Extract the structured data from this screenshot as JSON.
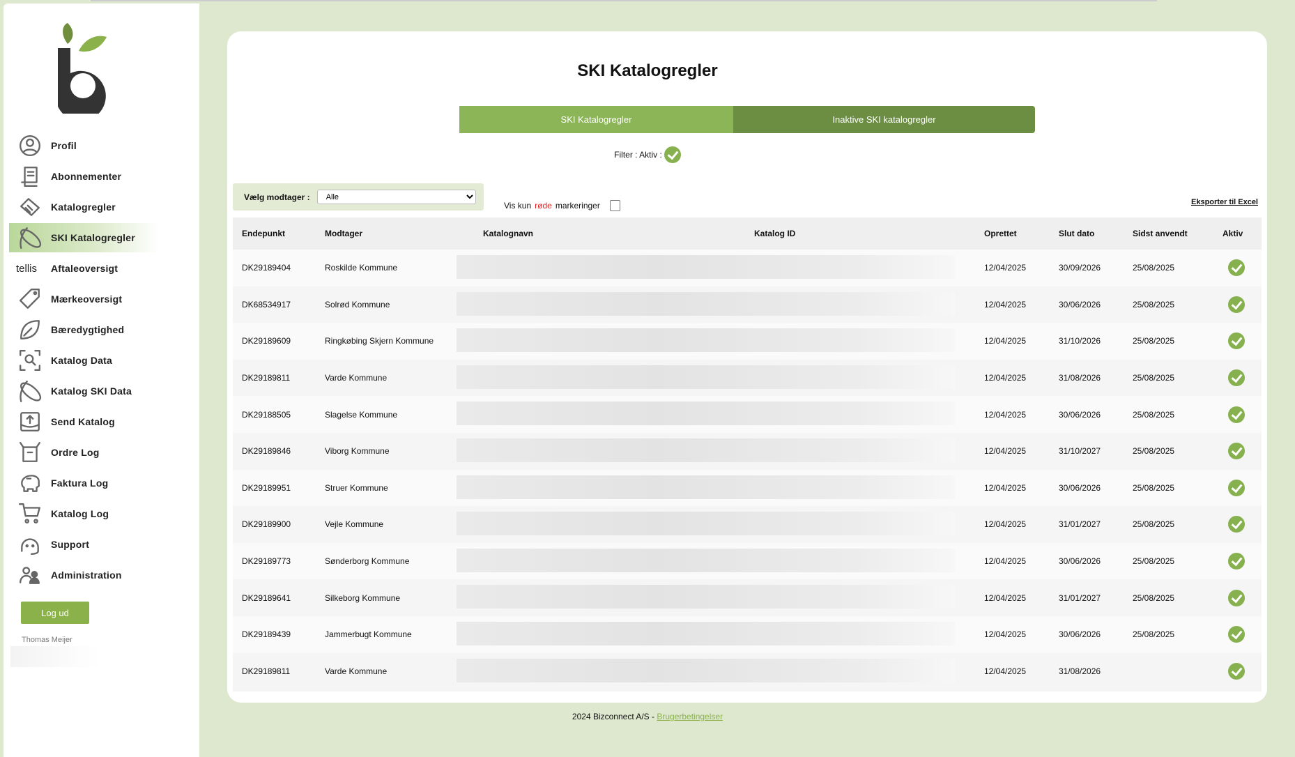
{
  "sidebar": {
    "items": [
      {
        "label": "Profil",
        "icon": "user-circle-icon"
      },
      {
        "label": "Abonnementer",
        "icon": "receipt-icon"
      },
      {
        "label": "Katalogregler",
        "icon": "handshake-icon"
      },
      {
        "label": "SKI Katalogregler",
        "icon": "ski-logo-icon",
        "active": true
      },
      {
        "label": "Aftaleoversigt",
        "icon": "tellis-logo-icon",
        "icon_text": "tellis"
      },
      {
        "label": "Mærkeoversigt",
        "icon": "tag-icon"
      },
      {
        "label": "Bæredygtighed",
        "icon": "leaf-icon"
      },
      {
        "label": "Katalog Data",
        "icon": "search-scan-icon"
      },
      {
        "label": "Katalog SKI Data",
        "icon": "ski-logo-icon"
      },
      {
        "label": "Send Katalog",
        "icon": "upload-tray-icon"
      },
      {
        "label": "Ordre Log",
        "icon": "box-icon"
      },
      {
        "label": "Faktura Log",
        "icon": "piggy-bank-icon"
      },
      {
        "label": "Katalog Log",
        "icon": "cart-icon"
      },
      {
        "label": "Support",
        "icon": "headset-icon"
      },
      {
        "label": "Administration",
        "icon": "users-icon"
      }
    ],
    "logout_label": "Log ud",
    "user_name": "Thomas Meijer"
  },
  "main": {
    "title": "SKI Katalogregler",
    "tabs": [
      {
        "label": "SKI Katalogregler"
      },
      {
        "label": "Inaktive SKI katalogregler"
      }
    ],
    "filter_label": "Filter : Aktiv :",
    "select_label": "Vælg modtager :",
    "select_value": "Alle",
    "red_only": {
      "pre": "Vis kun",
      "red": "røde",
      "post": "markeringer"
    },
    "export_label": "Eksporter til Excel",
    "columns": [
      "Endepunkt",
      "Modtager",
      "Katalognavn",
      "Katalog ID",
      "Oprettet",
      "Slut dato",
      "Sidst anvendt",
      "Aktiv"
    ],
    "rows": [
      {
        "endepunkt": "DK29189404",
        "modtager": "Roskilde Kommune",
        "oprettet": "12/04/2025",
        "slut": "30/09/2026",
        "sidst": "25/08/2025",
        "aktiv": true
      },
      {
        "endepunkt": "DK68534917",
        "modtager": "Solrød Kommune",
        "oprettet": "12/04/2025",
        "slut": "30/06/2026",
        "sidst": "25/08/2025",
        "aktiv": true
      },
      {
        "endepunkt": "DK29189609",
        "modtager": "Ringkøbing Skjern Kommune",
        "oprettet": "12/04/2025",
        "slut": "31/10/2026",
        "sidst": "25/08/2025",
        "aktiv": true
      },
      {
        "endepunkt": "DK29189811",
        "modtager": "Varde Kommune",
        "oprettet": "12/04/2025",
        "slut": "31/08/2026",
        "sidst": "25/08/2025",
        "aktiv": true
      },
      {
        "endepunkt": "DK29188505",
        "modtager": "Slagelse Kommune",
        "oprettet": "12/04/2025",
        "slut": "30/06/2026",
        "sidst": "25/08/2025",
        "aktiv": true
      },
      {
        "endepunkt": "DK29189846",
        "modtager": "Viborg Kommune",
        "oprettet": "12/04/2025",
        "slut": "31/10/2027",
        "sidst": "25/08/2025",
        "aktiv": true
      },
      {
        "endepunkt": "DK29189951",
        "modtager": "Struer Kommune",
        "oprettet": "12/04/2025",
        "slut": "30/06/2026",
        "sidst": "25/08/2025",
        "aktiv": true
      },
      {
        "endepunkt": "DK29189900",
        "modtager": "Vejle Kommune",
        "oprettet": "12/04/2025",
        "slut": "31/01/2027",
        "sidst": "25/08/2025",
        "aktiv": true
      },
      {
        "endepunkt": "DK29189773",
        "modtager": "Sønderborg Kommune",
        "oprettet": "12/04/2025",
        "slut": "30/06/2026",
        "sidst": "25/08/2025",
        "aktiv": true
      },
      {
        "endepunkt": "DK29189641",
        "modtager": "Silkeborg Kommune",
        "oprettet": "12/04/2025",
        "slut": "31/01/2027",
        "sidst": "25/08/2025",
        "aktiv": true
      },
      {
        "endepunkt": "DK29189439",
        "modtager": "Jammerbugt Kommune",
        "oprettet": "12/04/2025",
        "slut": "30/06/2026",
        "sidst": "25/08/2025",
        "aktiv": true
      },
      {
        "endepunkt": "DK29189811",
        "modtager": "Varde Kommune",
        "oprettet": "12/04/2025",
        "slut": "31/08/2026",
        "sidst": "",
        "aktiv": true
      }
    ]
  },
  "footer": {
    "text": "2024 Bizconnect A/S -",
    "link": "Brugerbetingelser"
  },
  "colors": {
    "accent": "#8bb556",
    "accent_dark": "#6b8e43",
    "check": "#86b14e",
    "background": "#dde8cf"
  }
}
